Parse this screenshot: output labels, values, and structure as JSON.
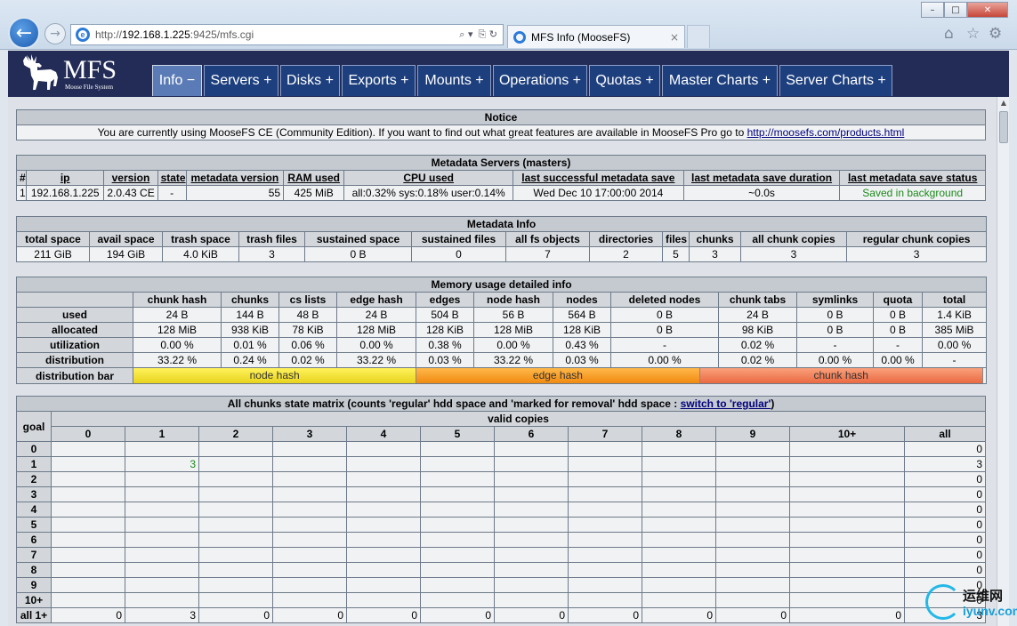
{
  "browser": {
    "url_prefix": "http://",
    "url_host": "192.168.1.225",
    "url_rest": ":9425/mfs.cgi",
    "tab_title": "MFS Info (MooseFS)",
    "search_glyph": "⌕ ▾",
    "addr_glyphs": "⎘ ↻",
    "tab_close": "×",
    "min": "–",
    "max": "□",
    "close": "✕",
    "home_icon": "⌂",
    "star_icon": "☆",
    "gear_icon": "⚙"
  },
  "logo": {
    "title": "MFS",
    "subtitle": "Moose File System"
  },
  "nav": [
    "Info −",
    "Servers +",
    "Disks +",
    "Exports +",
    "Mounts +",
    "Operations +",
    "Quotas +",
    "Master Charts +",
    "Server Charts +"
  ],
  "notice": {
    "title": "Notice",
    "text": "You are currently using MooseFS CE (Community Edition). If you want to find out what great features are available in MooseFS Pro go to ",
    "link": "http://moosefs.com/products.html"
  },
  "metadata_servers": {
    "title": "Metadata Servers (masters)",
    "headers": [
      "#",
      "ip",
      "version",
      "state",
      "metadata version",
      "RAM used",
      "CPU used",
      "last successful metadata save",
      "last metadata save duration",
      "last metadata save status"
    ],
    "row": [
      "1",
      "192.168.1.225",
      "2.0.43 CE",
      "-",
      "55",
      "425 MiB",
      "all:0.32% sys:0.18% user:0.14%",
      "Wed Dec 10 17:00:00 2014",
      "~0.0s",
      "Saved in background"
    ]
  },
  "metadata_info": {
    "title": "Metadata Info",
    "headers": [
      "total space",
      "avail space",
      "trash space",
      "trash files",
      "sustained space",
      "sustained files",
      "all fs objects",
      "directories",
      "files",
      "chunks",
      "all chunk copies",
      "regular chunk copies"
    ],
    "row": [
      "211 GiB",
      "194 GiB",
      "4.0 KiB",
      "3",
      "0 B",
      "0",
      "7",
      "2",
      "5",
      "3",
      "3",
      "3"
    ]
  },
  "memory": {
    "title": "Memory usage detailed info",
    "headers": [
      "",
      "chunk hash",
      "chunks",
      "cs lists",
      "edge hash",
      "edges",
      "node hash",
      "nodes",
      "deleted nodes",
      "chunk tabs",
      "symlinks",
      "quota",
      "total"
    ],
    "rows": [
      [
        "used",
        "24 B",
        "144 B",
        "48 B",
        "24 B",
        "504 B",
        "56 B",
        "564 B",
        "0 B",
        "24 B",
        "0 B",
        "0 B",
        "1.4 KiB"
      ],
      [
        "allocated",
        "128 MiB",
        "938 KiB",
        "78 KiB",
        "128 MiB",
        "128 KiB",
        "128 MiB",
        "128 KiB",
        "0 B",
        "98 KiB",
        "0 B",
        "0 B",
        "385 MiB"
      ],
      [
        "utilization",
        "0.00 %",
        "0.01 %",
        "0.06 %",
        "0.00 %",
        "0.38 %",
        "0.00 %",
        "0.43 %",
        "-",
        "0.02 %",
        "-",
        "-",
        "0.00 %"
      ],
      [
        "distribution",
        "33.22 %",
        "0.24 %",
        "0.02 %",
        "33.22 %",
        "0.03 %",
        "33.22 %",
        "0.03 %",
        "0.00 %",
        "0.02 %",
        "0.00 %",
        "0.00 %",
        "-"
      ]
    ],
    "bar_label": "distribution bar",
    "bar": [
      {
        "label": "node hash",
        "fraction": 0.3322
      },
      {
        "label": "edge hash",
        "fraction": 0.3322
      },
      {
        "label": "chunk hash",
        "fraction": 0.3322
      }
    ]
  },
  "chunks_matrix": {
    "title_prefix": "All chunks state matrix (counts 'regular' hdd space and 'marked for removal' hdd space : ",
    "title_link": "switch to 'regular'",
    "title_suffix": ")",
    "goal_label": "goal",
    "valid_label": "valid copies",
    "columns": [
      "0",
      "1",
      "2",
      "3",
      "4",
      "5",
      "6",
      "7",
      "8",
      "9",
      "10+",
      "all"
    ],
    "rows": [
      {
        "goal": "0",
        "cells": [
          "",
          "",
          "",
          "",
          "",
          "",
          "",
          "",
          "",
          "",
          "",
          "0"
        ]
      },
      {
        "goal": "1",
        "cells": [
          "",
          "3",
          "",
          "",
          "",
          "",
          "",
          "",
          "",
          "",
          "",
          "3"
        ]
      },
      {
        "goal": "2",
        "cells": [
          "",
          "",
          "",
          "",
          "",
          "",
          "",
          "",
          "",
          "",
          "",
          "0"
        ]
      },
      {
        "goal": "3",
        "cells": [
          "",
          "",
          "",
          "",
          "",
          "",
          "",
          "",
          "",
          "",
          "",
          "0"
        ]
      },
      {
        "goal": "4",
        "cells": [
          "",
          "",
          "",
          "",
          "",
          "",
          "",
          "",
          "",
          "",
          "",
          "0"
        ]
      },
      {
        "goal": "5",
        "cells": [
          "",
          "",
          "",
          "",
          "",
          "",
          "",
          "",
          "",
          "",
          "",
          "0"
        ]
      },
      {
        "goal": "6",
        "cells": [
          "",
          "",
          "",
          "",
          "",
          "",
          "",
          "",
          "",
          "",
          "",
          "0"
        ]
      },
      {
        "goal": "7",
        "cells": [
          "",
          "",
          "",
          "",
          "",
          "",
          "",
          "",
          "",
          "",
          "",
          "0"
        ]
      },
      {
        "goal": "8",
        "cells": [
          "",
          "",
          "",
          "",
          "",
          "",
          "",
          "",
          "",
          "",
          "",
          "0"
        ]
      },
      {
        "goal": "9",
        "cells": [
          "",
          "",
          "",
          "",
          "",
          "",
          "",
          "",
          "",
          "",
          "",
          "0"
        ]
      },
      {
        "goal": "10+",
        "cells": [
          "",
          "",
          "",
          "",
          "",
          "",
          "",
          "",
          "",
          "",
          "",
          "0"
        ]
      },
      {
        "goal": "all 1+",
        "cells": [
          "0",
          "3",
          "0",
          "0",
          "0",
          "0",
          "0",
          "0",
          "0",
          "0",
          "0",
          "3"
        ]
      }
    ]
  },
  "watermark": {
    "cn": "运维网",
    "en": "iyunv.com"
  }
}
